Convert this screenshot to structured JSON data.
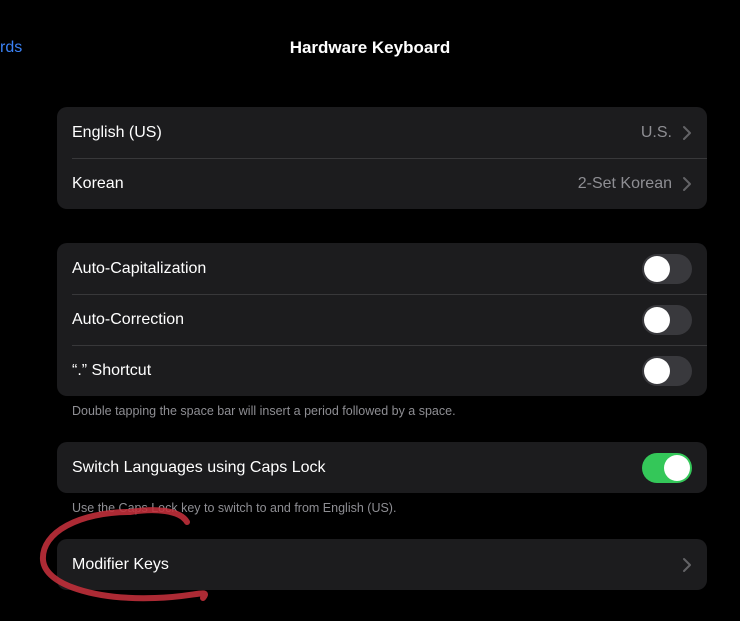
{
  "nav": {
    "back_label": "rds",
    "title": "Hardware Keyboard"
  },
  "keyboards": [
    {
      "label": "English (US)",
      "value": "U.S."
    },
    {
      "label": "Korean",
      "value": "2-Set Korean"
    }
  ],
  "options": [
    {
      "label": "Auto-Capitalization",
      "on": false
    },
    {
      "label": "Auto-Correction",
      "on": false
    },
    {
      "label": "“.” Shortcut",
      "on": false
    }
  ],
  "options_footnote": "Double tapping the space bar will insert a period followed by a space.",
  "caps_lock": {
    "label": "Switch Languages using Caps Lock",
    "on": true
  },
  "caps_lock_footnote": "Use the Caps Lock key to switch to and from English (US).",
  "modifier_keys": {
    "label": "Modifier Keys"
  },
  "colors": {
    "accent": "#3b82f6",
    "toggle_on": "#34c759",
    "annotation": "#c4303b"
  }
}
